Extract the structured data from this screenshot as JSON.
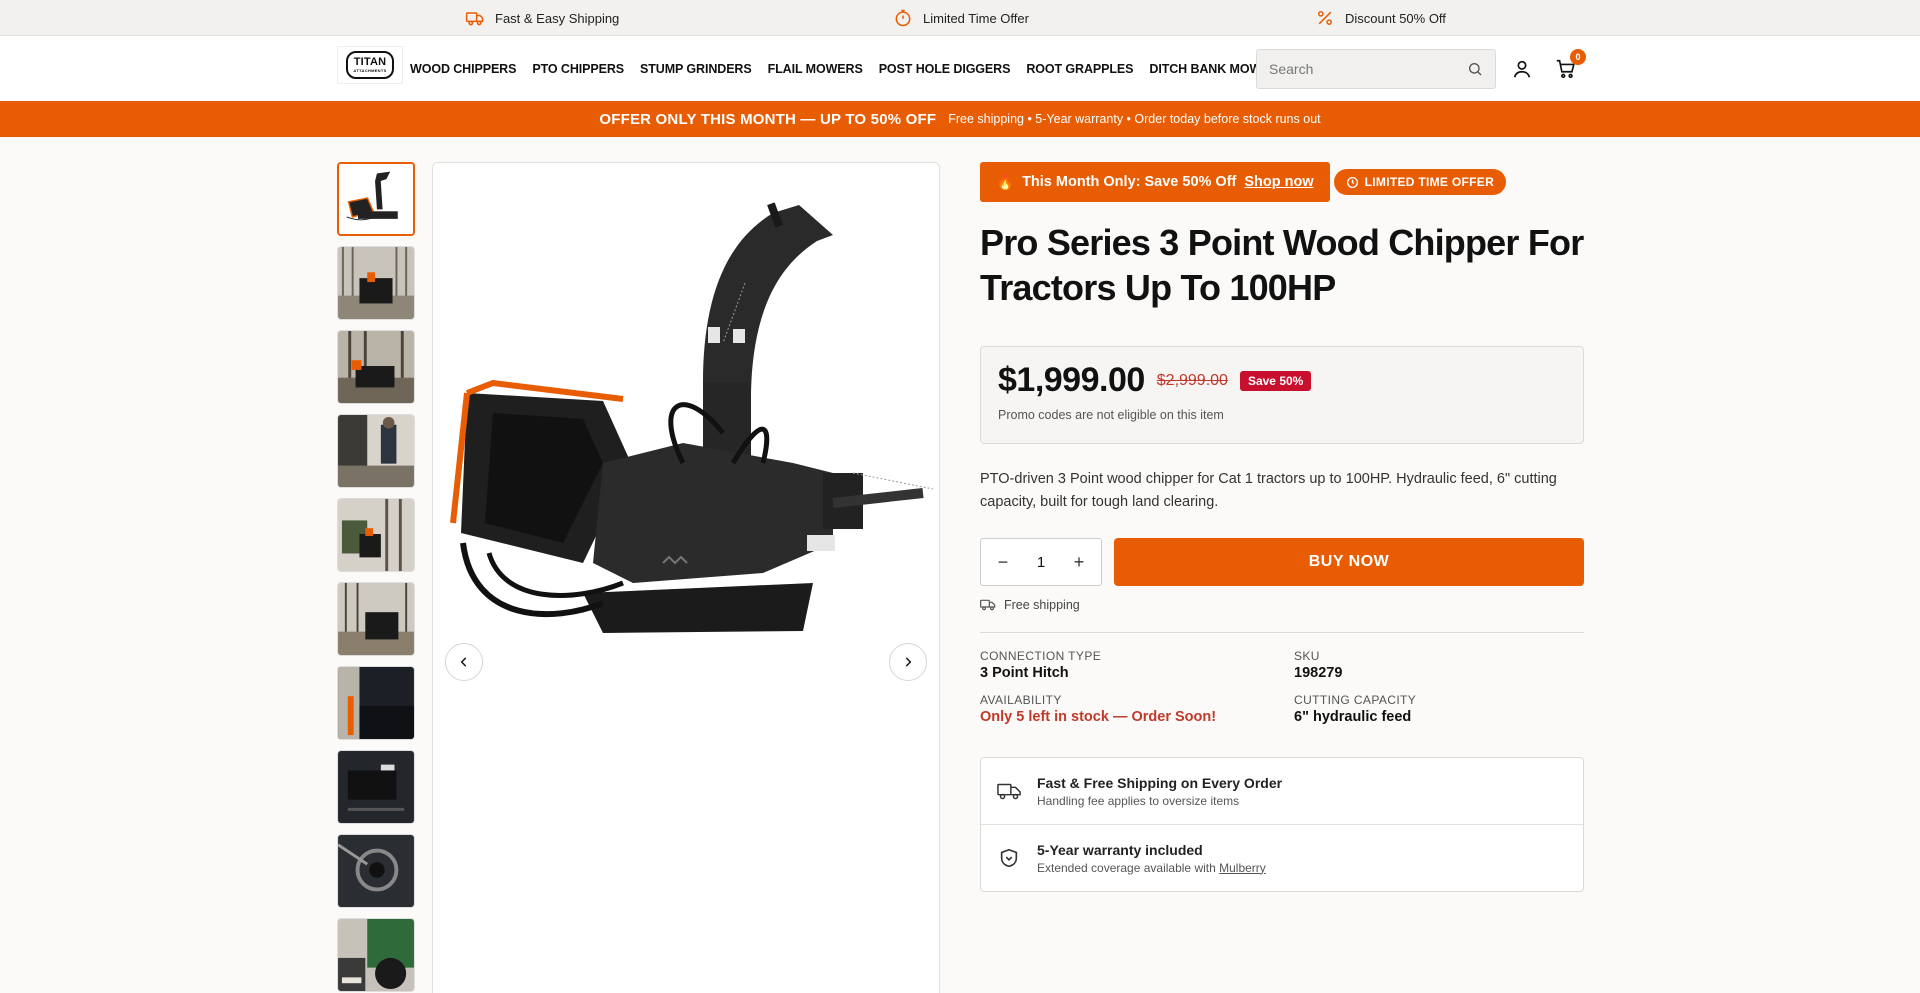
{
  "topbar": {
    "items": [
      {
        "label": "Fast & Easy Shipping",
        "icon": "truck-icon"
      },
      {
        "label": "Limited Time Offer",
        "icon": "stopwatch-icon"
      },
      {
        "label": "Discount 50% Off",
        "icon": "percent-icon"
      }
    ]
  },
  "header": {
    "logo_text": "TITAN",
    "logo_subtext": "ATTACHMENTS",
    "nav": [
      "WOOD CHIPPERS",
      "PTO CHIPPERS",
      "STUMP GRINDERS",
      "FLAIL MOWERS",
      "POST HOLE DIGGERS",
      "ROOT GRAPPLES",
      "DITCH BANK MOWERS"
    ],
    "search_placeholder": "Search",
    "cart_count": "0"
  },
  "promobar": {
    "headline": "OFFER ONLY THIS MONTH — UP TO 50% OFF",
    "details": "Free shipping • 5-Year warranty • Order today before stock runs out"
  },
  "product": {
    "offer_emoji": "🔥",
    "offer_text": "This Month Only: Save 50% Off",
    "offer_link": "Shop now",
    "badge": "LIMITED TIME OFFER",
    "title": "Pro Series 3 Point Wood Chipper For Tractors Up To 100HP",
    "price": "$1,999.00",
    "compare_price": "$2,999.00",
    "save_label": "Save 50%",
    "promo_note": "Promo codes are not eligible on this item",
    "description": "PTO-driven 3 Point wood chipper for Cat 1 tractors up to 100HP. Hydraulic feed, 6\" cutting capacity, built for tough land clearing.",
    "quantity": "1",
    "buy_label": "BUY NOW",
    "shipping_note": "Free shipping",
    "specs": [
      {
        "key": "CONNECTION TYPE",
        "value": "3 Point Hitch"
      },
      {
        "key": "SKU",
        "value": "198279"
      },
      {
        "key": "AVAILABILITY",
        "value": "Only 5 left in stock — Order Soon!"
      },
      {
        "key": "CUTTING CAPACITY",
        "value": "6\" hydraulic feed"
      }
    ],
    "perks": [
      {
        "title": "Fast & Free Shipping on Every Order",
        "subtitle": "Handling fee applies to oversize items"
      },
      {
        "title": "5-Year warranty included",
        "subtitle_prefix": "Extended coverage available with ",
        "subtitle_link": "Mulberry"
      }
    ]
  },
  "colors": {
    "accent": "#e85d04",
    "sale": "#c8102e",
    "alert_text": "#c0392b"
  }
}
